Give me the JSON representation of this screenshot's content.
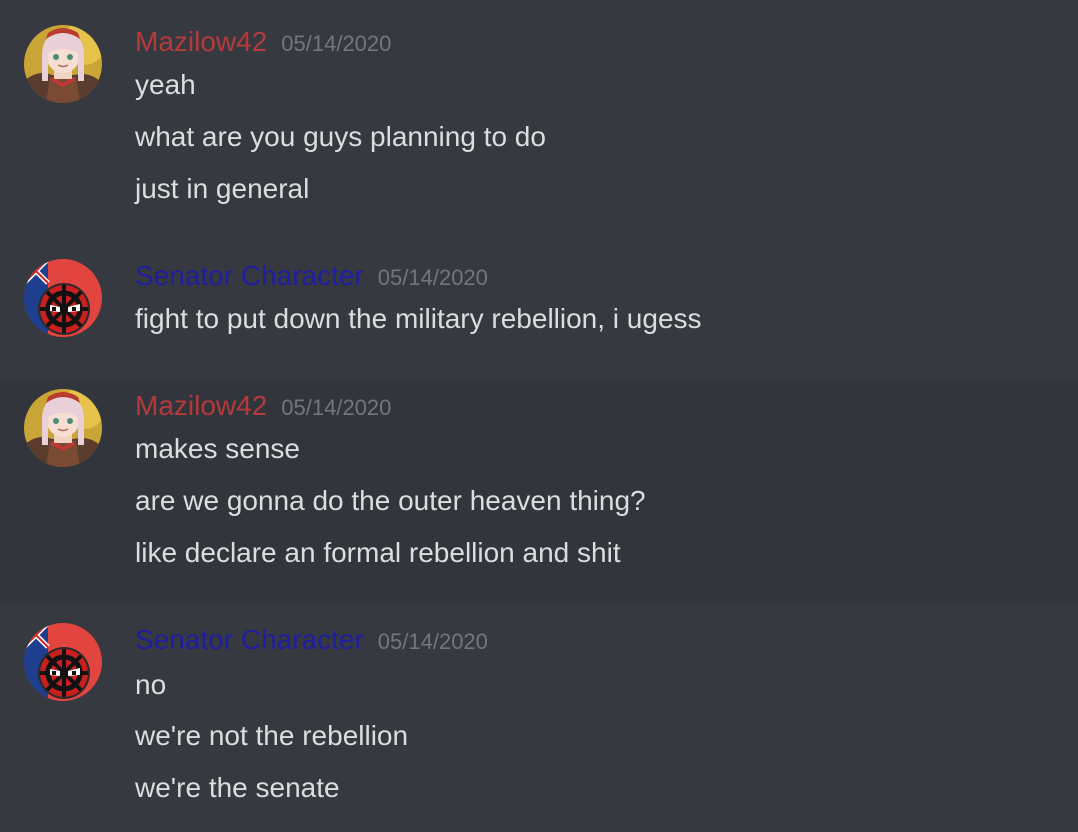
{
  "colors": {
    "background": "#36393f",
    "hover_background": "#32353b",
    "text": "#dcddde",
    "timestamp": "#72767d",
    "mazilow_name": "#b53a3c",
    "senator_name": "#1f1ea0"
  },
  "messages": [
    {
      "username": "Mazilow42",
      "timestamp": "05/14/2020",
      "avatar": "anime-girl-avatar",
      "lines": [
        "yeah",
        "what are you guys planning to do",
        "just in general"
      ]
    },
    {
      "username": "Senator Character",
      "timestamp": "05/14/2020",
      "avatar": "countryball-avatar",
      "lines": [
        "fight to put down the military rebellion, i ugess"
      ]
    },
    {
      "username": "Mazilow42",
      "timestamp": "05/14/2020",
      "avatar": "anime-girl-avatar",
      "lines": [
        "makes sense",
        "are we gonna do the outer heaven thing?",
        "like declare an formal rebellion and shit"
      ]
    },
    {
      "username": "Senator Character",
      "timestamp": "05/14/2020",
      "avatar": "countryball-avatar",
      "lines": [
        "no",
        "we're not the rebellion",
        "we're the senate"
      ]
    }
  ]
}
